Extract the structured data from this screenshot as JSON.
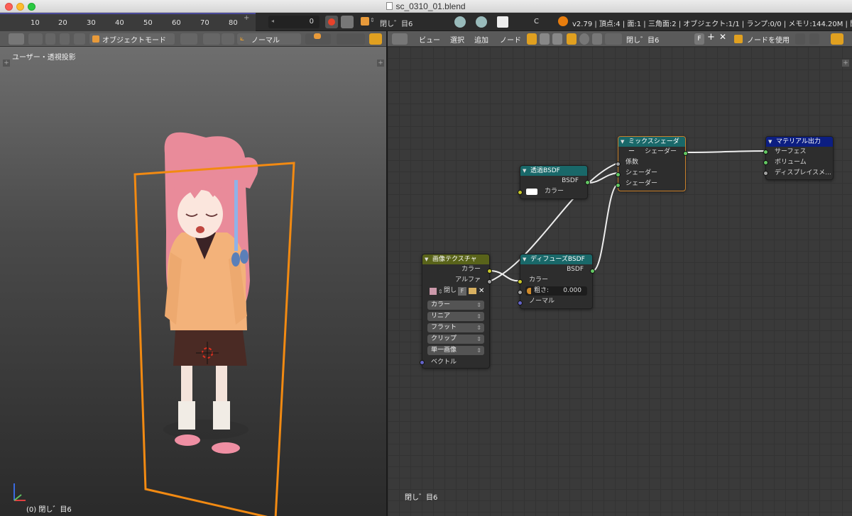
{
  "window": {
    "title": "sc_0310_01.blend"
  },
  "timeline": {
    "ticks": [
      "10",
      "20",
      "30",
      "40",
      "50",
      "60",
      "70",
      "80"
    ],
    "current_frame": "0"
  },
  "info_bar": {
    "scene": "閉し゛目6",
    "render_engine": "C",
    "stats": "v2.79 | 頂点:4 | 面:1 | 三角面:2 | オブジェクト:1/1 | ランプ:0/0 | メモリ:144.20M | 閉し゛目6"
  },
  "viewport": {
    "header": {
      "mode": "オブジェクトモード",
      "orientation": "ノーマル"
    },
    "view_label": "ユーザー・透視投影",
    "footer": "(0) 閉し゛目6"
  },
  "node_editor": {
    "menu": [
      "ビュー",
      "選択",
      "追加",
      "ノード"
    ],
    "material_name": "閉し゛目6",
    "fake_user": "F",
    "use_nodes": "ノードを使用",
    "footer": "閉し゛目6",
    "nodes": {
      "transparent": {
        "title": "透過BSDF",
        "out": "BSDF",
        "in_color": "カラー",
        "color": "#7a2a2a"
      },
      "mix": {
        "title": "ミックスシェーダー",
        "out": "シェーダー",
        "in_fac": "係数",
        "in_s1": "シェーダー",
        "in_s2": "シェーダー",
        "color": "#7a2a2a"
      },
      "output": {
        "title": "マテリアル出力",
        "in_surface": "サーフェス",
        "in_volume": "ボリューム",
        "in_displacement": "ディスプレイスメ...",
        "color": "#2a2a7a"
      },
      "image": {
        "title": "画像テクスチャ",
        "out_color": "カラー",
        "out_alpha": "アルファ",
        "image_name": "閉し",
        "image_f": "F",
        "opt_color": "カラー",
        "opt_interp": "リニア",
        "opt_proj": "フラット",
        "opt_ext": "クリップ",
        "opt_source": "単一画像",
        "in_vector": "ベクトル",
        "color": "#5a5a2a"
      },
      "diffuse": {
        "title": "ディフューズBSDF",
        "out": "BSDF",
        "in_color": "カラー",
        "roughness_label": "粗さ:",
        "roughness": "0.000",
        "in_normal": "ノーマル",
        "color": "#7a2a2a"
      }
    }
  },
  "colors": {
    "accent": "#e88a1a",
    "header_bar": "#5a5a5a",
    "shader_node": "#196869",
    "output_node": "#0c1e82",
    "texture_node": "#59631a"
  }
}
